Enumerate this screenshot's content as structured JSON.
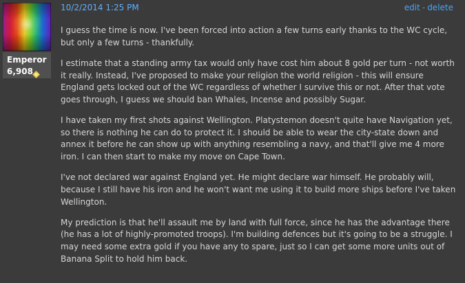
{
  "user": {
    "name": "Emperor",
    "score": "6,908",
    "badge_icon": "gold-diamond-icon"
  },
  "post": {
    "date": "10/2/2014 1:25 PM",
    "actions": {
      "edit": "edit",
      "separator": "-",
      "delete": "delete"
    },
    "paragraphs": [
      "I guess the time is now. I've been forced into action a few turns early thanks to the WC cycle, but only a few turns - thankfully.",
      "I estimate that a standing army tax would only have cost him about 8 gold per turn - not worth it really. Instead, I've proposed to make your religion the world religion - this will ensure England gets locked out of the WC regardless of whether I survive this or not. After that vote goes through, I guess we should ban Whales, Incense and possibly Sugar.",
      "I have taken my first shots against Wellington. Platystemon doesn't quite have Navigation yet, so there is nothing he can do to protect it. I should be able to wear the city-state down and annex it before he can show up with anything resembling a navy, and that'll give me 4 more iron. I can then start to make my move on Cape Town.",
      "I've not declared war against England yet. He might declare war himself. He probably will, because I still have his iron and he won't want me using it to build more ships before I've taken Wellington.",
      "My prediction is that he'll assault me by land with full force, since he has the advantage there (he has a lot of highly-promoted troops). I'm building defences but it's going to be a struggle. I may need some extra gold if you have any to spare, just so I can get some more units out of Banana Split to hold him back."
    ]
  },
  "colors": {
    "background": "#3b3b3b",
    "text": "#d6d6d6",
    "link": "#4aa3ff",
    "date": "#5fb0ff",
    "user_box": "#505050",
    "badge": "#e8c63a"
  }
}
